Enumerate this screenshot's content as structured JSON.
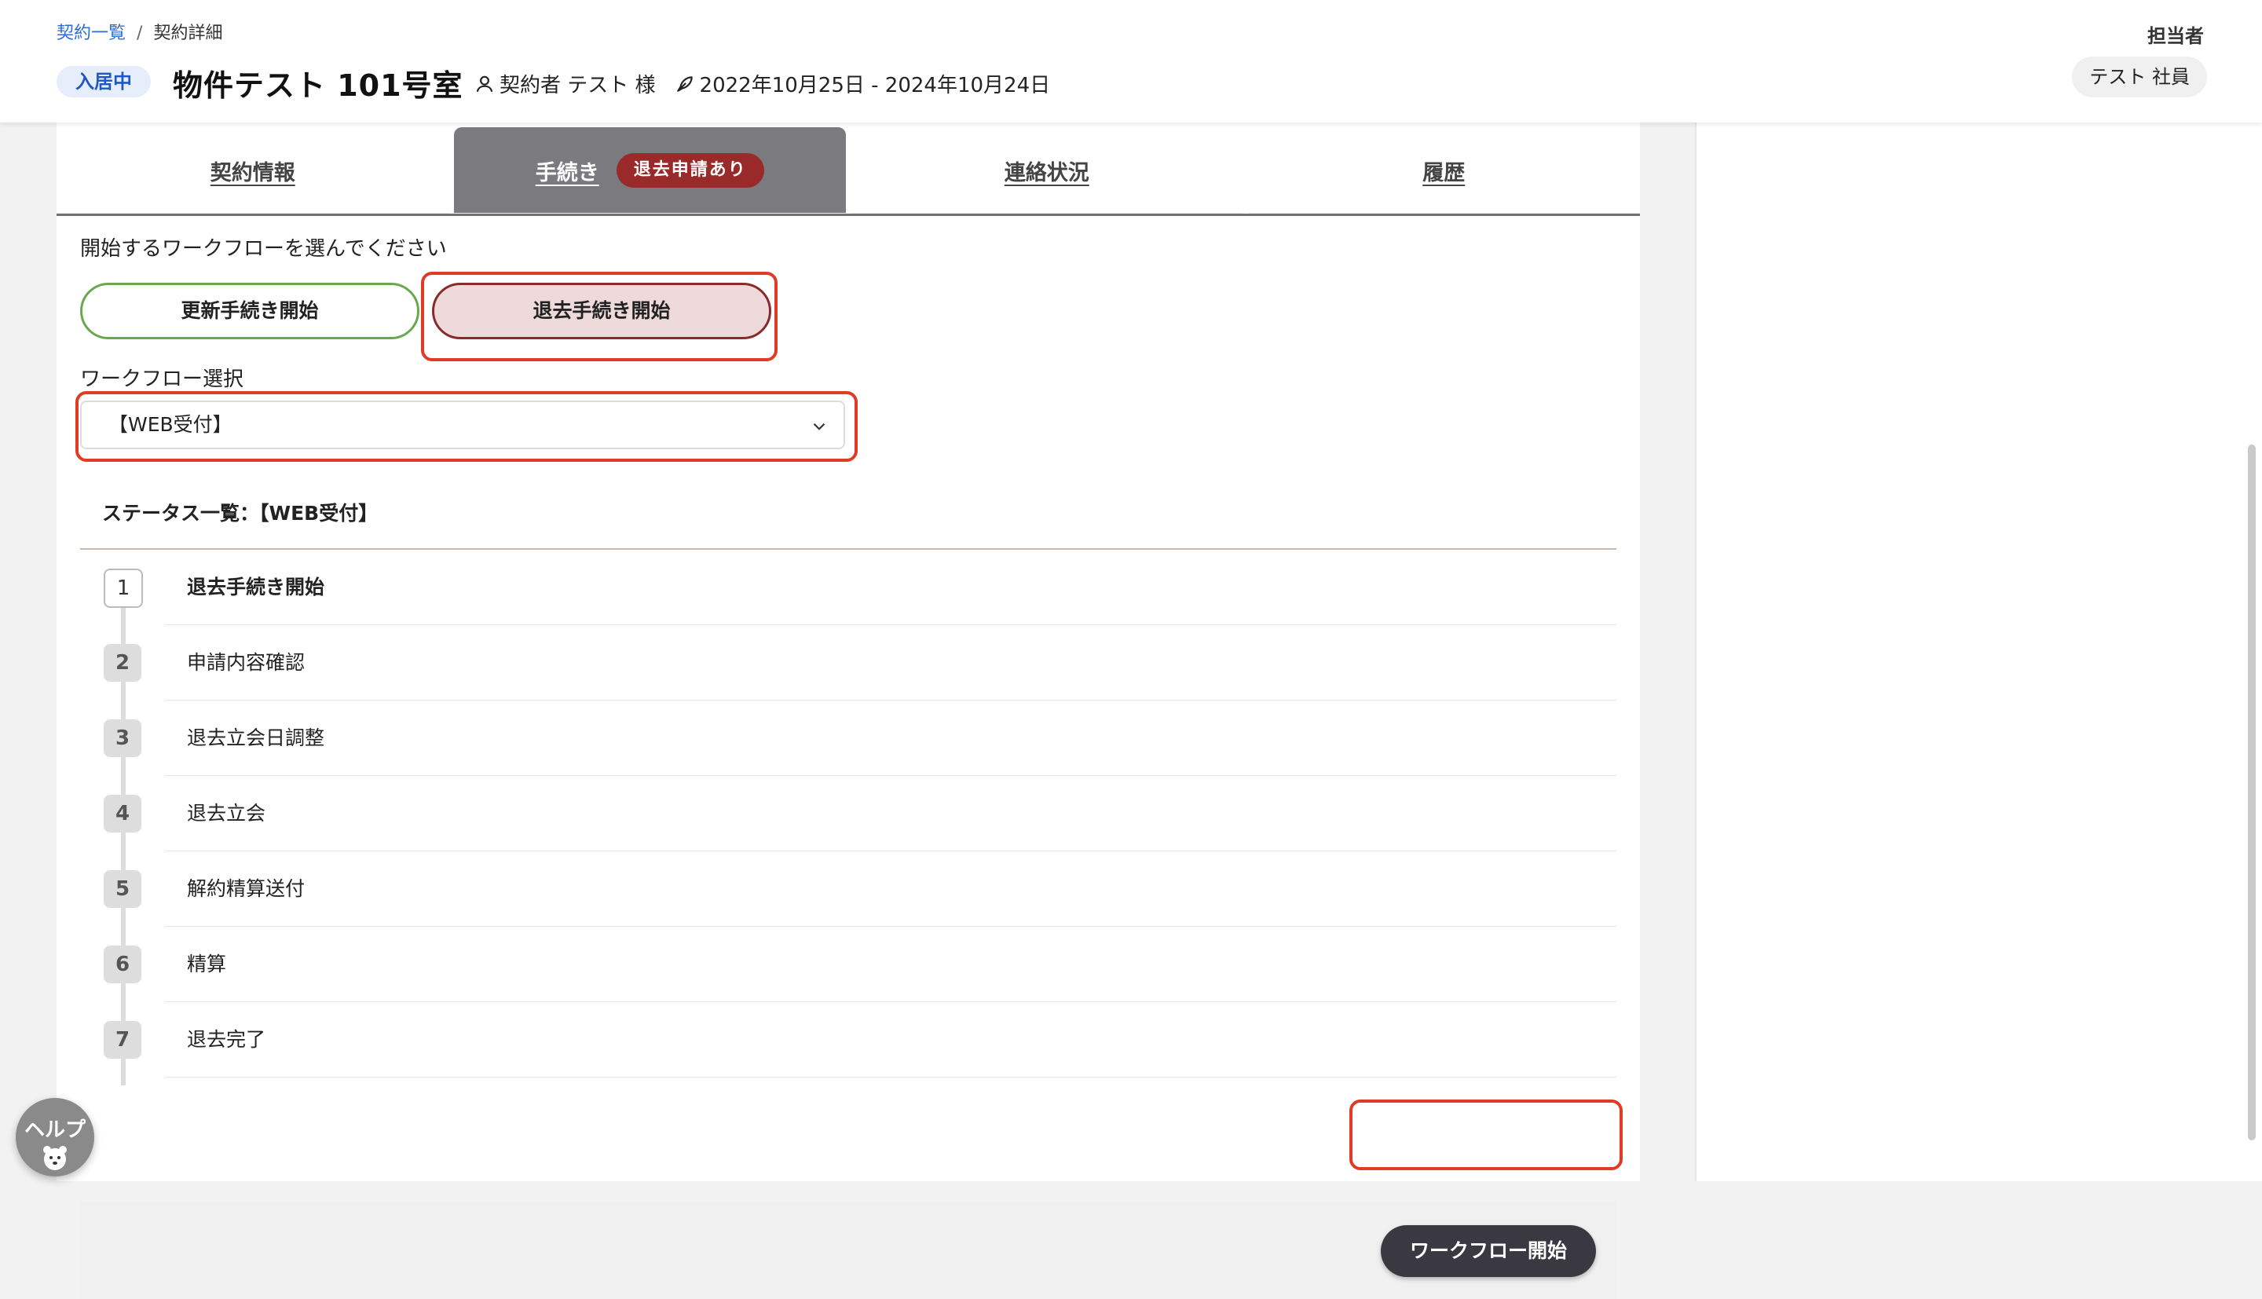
{
  "breadcrumb": {
    "root": "契約一覧",
    "separator": "/",
    "current": "契約詳細"
  },
  "header": {
    "status": "入居中",
    "title": "物件テスト 101号室",
    "contractor": "契約者 テスト 様",
    "period": "2022年10月25日 - 2024年10月24日",
    "assignee_label": "担当者",
    "assignee": "テスト 社員"
  },
  "tabs": [
    {
      "label": "契約情報"
    },
    {
      "label": "手続き",
      "badge": "退去申請あり",
      "active": true
    },
    {
      "label": "連絡状況"
    },
    {
      "label": "履歴"
    }
  ],
  "workflow": {
    "prompt": "開始するワークフローを選んでください",
    "renew_button": "更新手続き開始",
    "exit_button": "退去手続き開始",
    "select_label": "ワークフロー選択",
    "select_value": "【WEB受付】",
    "status_title": "ステータス一覧：【WEB受付】",
    "start_button": "ワークフロー開始"
  },
  "steps": [
    {
      "num": "1",
      "name": "退去手続き開始"
    },
    {
      "num": "2",
      "name": "申請内容確認"
    },
    {
      "num": "3",
      "name": "退去立会日調整"
    },
    {
      "num": "4",
      "name": "退去立会"
    },
    {
      "num": "5",
      "name": "解約精算送付"
    },
    {
      "num": "6",
      "name": "精算"
    },
    {
      "num": "7",
      "name": "退去完了"
    }
  ],
  "help": {
    "label": "ヘルプ"
  },
  "colors": {
    "accent_blue": "#2b6fd6",
    "active_tab": "#7b7a7f",
    "badge_red": "#9a2a2a",
    "highlight_red": "#e03b24",
    "renew_green": "#6aa84f"
  }
}
